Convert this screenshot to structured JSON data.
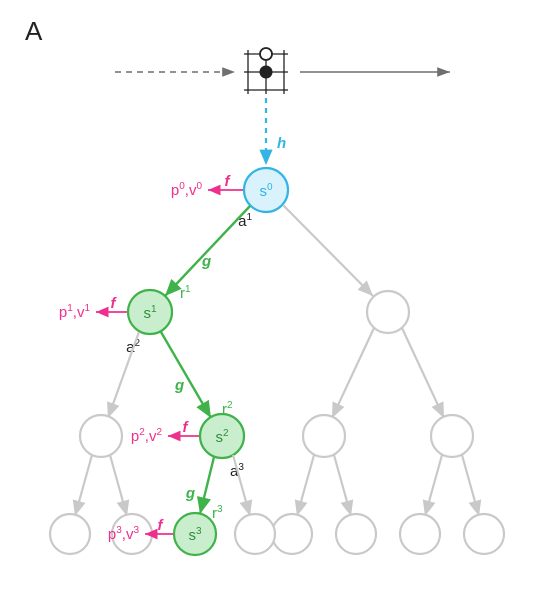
{
  "panel": {
    "letter": "A"
  },
  "colors": {
    "pink": "#ef2f8e",
    "blue": "#33b4e5",
    "green": "#3fb24a",
    "green_dark": "#2f8f3c",
    "grey": "#c9c9c9",
    "grey_dark": "#6f6f6f",
    "black": "#222222"
  },
  "functions": {
    "h_label": "h",
    "g_label": "g",
    "f_label": "f"
  },
  "nodes": {
    "s0": {
      "label_base": "s",
      "label_sup": "0"
    },
    "s1": {
      "label_base": "s",
      "label_sup": "1"
    },
    "s2": {
      "label_base": "s",
      "label_sup": "2"
    },
    "s3": {
      "label_base": "s",
      "label_sup": "3"
    }
  },
  "actions": {
    "a1": {
      "base": "a",
      "sup": "1"
    },
    "a2": {
      "base": "a",
      "sup": "2"
    },
    "a3": {
      "base": "a",
      "sup": "3"
    }
  },
  "rewards": {
    "r1": {
      "base": "r",
      "sup": "1"
    },
    "r2": {
      "base": "r",
      "sup": "2"
    },
    "r3": {
      "base": "r",
      "sup": "3"
    }
  },
  "predictions": {
    "pv0": {
      "p_base": "p",
      "p_sup": "0",
      "v_base": "v",
      "v_sup": "0"
    },
    "pv1": {
      "p_base": "p",
      "p_sup": "1",
      "v_base": "v",
      "v_sup": "1"
    },
    "pv2": {
      "p_base": "p",
      "p_sup": "2",
      "v_base": "v",
      "v_sup": "2"
    },
    "pv3": {
      "p_base": "p",
      "p_sup": "3",
      "v_base": "v",
      "v_sup": "3"
    }
  }
}
